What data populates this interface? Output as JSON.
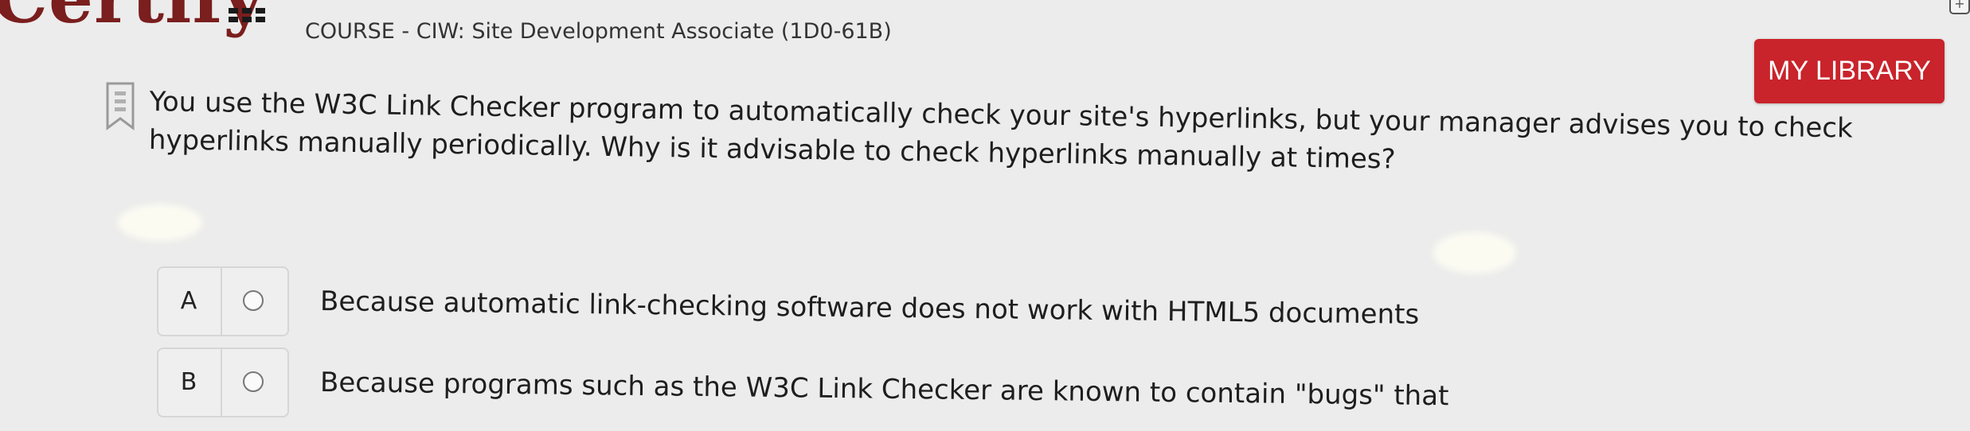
{
  "header": {
    "logo_text": "Certify",
    "course_title": "COURSE - CIW: Site Development Associate (1D0-61B)",
    "my_library_label": "MY LIBRARY"
  },
  "icons": {
    "menu": "grid-menu-icon",
    "flag": "bookmark-flag-icon",
    "top_right": "new-window-icon"
  },
  "colors": {
    "accent": "#c9232b",
    "logo": "#7a1e1e",
    "background": "#ececec"
  },
  "question": {
    "text": "You use the W3C Link Checker program to automatically check your site's hyperlinks, but your manager advises you to check hyperlinks manually periodically. Why is it advisable to check hyperlinks manually at times?"
  },
  "options": [
    {
      "letter": "A",
      "text": "Because automatic link-checking software does not work with HTML5 documents"
    },
    {
      "letter": "B",
      "text": "Because programs such as the W3C Link Checker are known to contain \"bugs\" that"
    }
  ]
}
